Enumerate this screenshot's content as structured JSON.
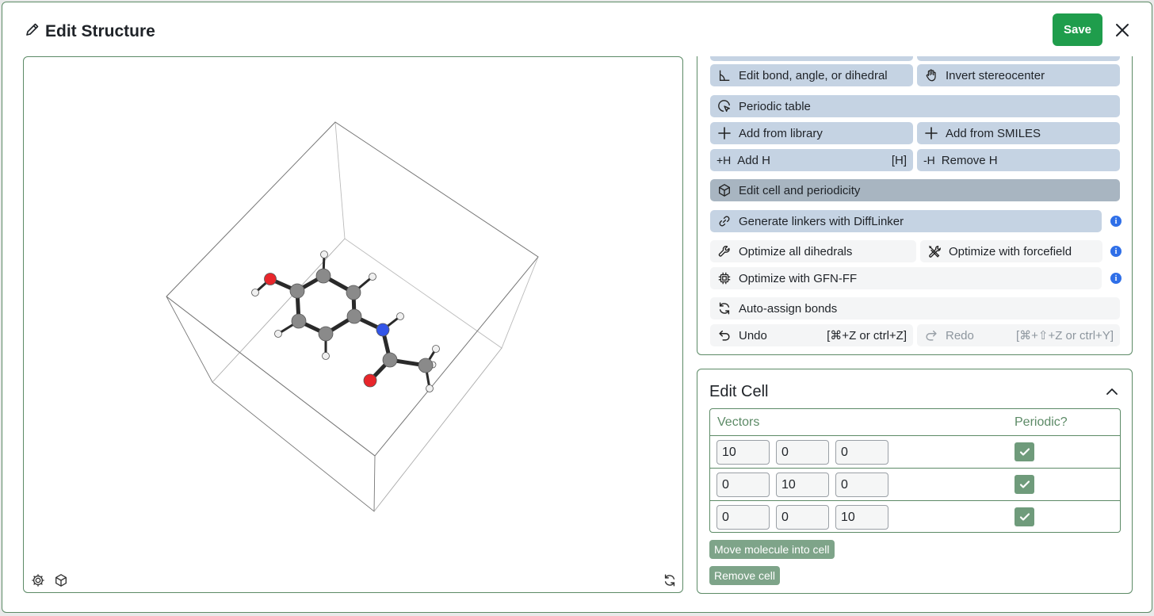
{
  "dialog": {
    "title": "Edit Structure",
    "save_label": "Save",
    "icons": {
      "title": "pencil-icon",
      "close": "close-icon"
    }
  },
  "viewer": {
    "icons": [
      "settings-gear-icon",
      "cube-icon",
      "refresh-icon"
    ]
  },
  "tools": {
    "edit_geometry_label": "Edit bond, angle, or dihedral",
    "invert_label": "Invert stereocenter",
    "periodic_table_label": "Periodic table",
    "add_library_label": "Add from library",
    "add_smiles_label": "Add from SMILES",
    "add_h_prefix": "+H",
    "add_h_label": "Add H",
    "add_h_shortcut": "[H]",
    "remove_h_prefix": "-H",
    "remove_h_label": "Remove H",
    "edit_cell_label": "Edit cell and periodicity",
    "difflinker_label": "Generate linkers with DiffLinker",
    "opt_dihedrals_label": "Optimize all dihedrals",
    "opt_forcefield_label": "Optimize with forcefield",
    "opt_gfnff_label": "Optimize with GFN-FF",
    "auto_bonds_label": "Auto-assign bonds",
    "undo_label": "Undo",
    "undo_shortcut": "[⌘+Z or ctrl+Z]",
    "redo_label": "Redo",
    "redo_shortcut": "[⌘+⇧+Z or ctrl+Y]",
    "info_glyph": "i"
  },
  "edit_cell": {
    "title": "Edit Cell",
    "col_vectors": "Vectors",
    "col_periodic": "Periodic?",
    "rows": [
      {
        "values": [
          "10",
          "0",
          "0"
        ],
        "periodic": true
      },
      {
        "values": [
          "0",
          "10",
          "0"
        ],
        "periodic": true
      },
      {
        "values": [
          "0",
          "0",
          "10"
        ],
        "periodic": true
      }
    ],
    "move_label": "Move molecule into cell",
    "remove_label": "Remove cell"
  },
  "colors": {
    "accent_green": "#1f9d4c",
    "border_green": "#5c8a66",
    "tool_blue": "#c5d3e3",
    "carbon": "#808080",
    "oxygen": "#e8262b",
    "nitrogen": "#3355e8",
    "hydrogen": "#f2f2f2"
  }
}
